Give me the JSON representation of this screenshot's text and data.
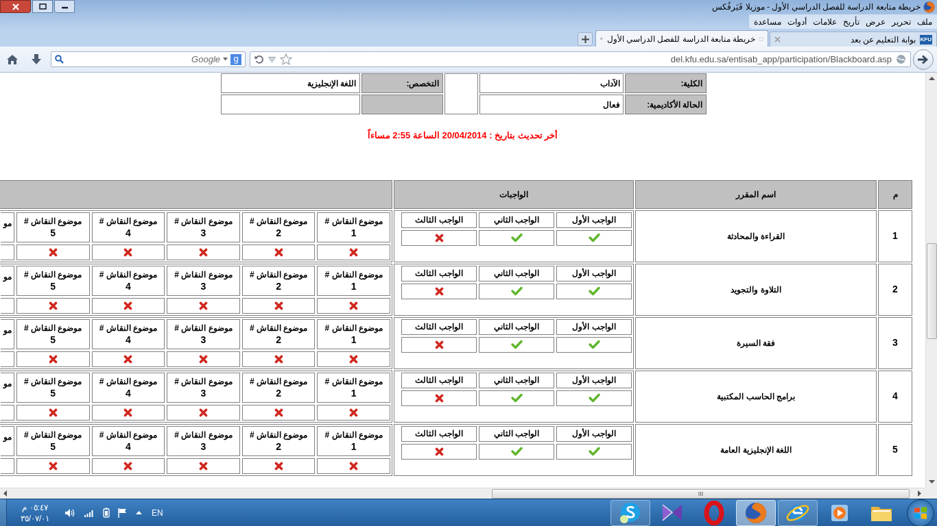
{
  "window": {
    "title": "خريطة متابعة الدراسة للفصل الدراسي الأول - موزيلا فَيَرفُكس"
  },
  "menu": [
    "ملف",
    "تحرير",
    "عرض",
    "تأريخ",
    "علامات",
    "أدوات",
    "مساعدة"
  ],
  "tabs": [
    {
      "label": "بوابة التعليم عن بعد",
      "favicon_text": "KFU",
      "selected": false
    },
    {
      "label": "خريطة متابعة الدراسة للفصل الدراسي الأول",
      "selected": true
    }
  ],
  "search": {
    "placeholder": "Google",
    "engine_badge": "g"
  },
  "address_bar": {
    "url": "del.kfu.edu.sa/entisab_app/participation/Blackboard.asp"
  },
  "student_info": [
    {
      "label": "الكلية:",
      "value": "الآداب"
    },
    {
      "label": "التخصص:",
      "value": "اللغة الإنجليزية"
    },
    {
      "label": "الحالة الأكاديمية:",
      "value": "فعال"
    }
  ],
  "last_update": "أخر تحديث بتاريخ : 20/04/2014 الساعة 2:55 مساءاً",
  "table": {
    "columns": [
      "م",
      "اسم المقرر",
      "الواجبات"
    ],
    "rows": [
      {
        "number": "1",
        "course": "القراءة والمحادثة",
        "assignments": [
          {
            "label": "الواجب الأول",
            "done": true
          },
          {
            "label": "الواجب الثاني",
            "done": true
          },
          {
            "label": "الواجب الثالث",
            "done": false
          }
        ],
        "discussions": [
          {
            "label": "موضوع النقاش #",
            "number": "1",
            "done": false
          },
          {
            "label": "موضوع النقاش #",
            "number": "2",
            "done": false
          },
          {
            "label": "موضوع النقاش #",
            "number": "3",
            "done": false
          },
          {
            "label": "موضوع النقاش #",
            "number": "4",
            "done": false
          },
          {
            "label": "موضوع النقاش #",
            "number": "5",
            "done": false
          }
        ],
        "discussion_cut": "مو"
      },
      {
        "number": "2",
        "course": "التلاوة والتجويد",
        "assignments": [
          {
            "label": "الواجب الأول",
            "done": true
          },
          {
            "label": "الواجب الثاني",
            "done": true
          },
          {
            "label": "الواجب الثالث",
            "done": false
          }
        ],
        "discussions": [
          {
            "label": "موضوع النقاش #",
            "number": "1",
            "done": false
          },
          {
            "label": "موضوع النقاش #",
            "number": "2",
            "done": false
          },
          {
            "label": "موضوع النقاش #",
            "number": "3",
            "done": false
          },
          {
            "label": "موضوع النقاش #",
            "number": "4",
            "done": false
          },
          {
            "label": "موضوع النقاش #",
            "number": "5",
            "done": false
          }
        ],
        "discussion_cut": "مو"
      },
      {
        "number": "3",
        "course": "فقة السيرة",
        "assignments": [
          {
            "label": "الواجب الأول",
            "done": true
          },
          {
            "label": "الواجب الثاني",
            "done": true
          },
          {
            "label": "الواجب الثالث",
            "done": false
          }
        ],
        "discussions": [
          {
            "label": "موضوع النقاش #",
            "number": "1",
            "done": false
          },
          {
            "label": "موضوع النقاش #",
            "number": "2",
            "done": false
          },
          {
            "label": "موضوع النقاش #",
            "number": "3",
            "done": false
          },
          {
            "label": "موضوع النقاش #",
            "number": "4",
            "done": false
          },
          {
            "label": "موضوع النقاش #",
            "number": "5",
            "done": false
          }
        ],
        "discussion_cut": "مو"
      },
      {
        "number": "4",
        "course": "برامج الحاسب المكتبية",
        "assignments": [
          {
            "label": "الواجب الأول",
            "done": true
          },
          {
            "label": "الواجب الثاني",
            "done": true
          },
          {
            "label": "الواجب الثالث",
            "done": false
          }
        ],
        "discussions": [
          {
            "label": "موضوع النقاش #",
            "number": "1",
            "done": false
          },
          {
            "label": "موضوع النقاش #",
            "number": "2",
            "done": false
          },
          {
            "label": "موضوع النقاش #",
            "number": "3",
            "done": false
          },
          {
            "label": "موضوع النقاش #",
            "number": "4",
            "done": false
          },
          {
            "label": "موضوع النقاش #",
            "number": "5",
            "done": false
          }
        ],
        "discussion_cut": "مو"
      },
      {
        "number": "5",
        "course": "اللغة الإنجليزية العامة",
        "assignments": [
          {
            "label": "الواجب الأول",
            "done": true
          },
          {
            "label": "الواجب الثاني",
            "done": true
          },
          {
            "label": "الواجب الثالث",
            "done": false
          }
        ],
        "discussions": [
          {
            "label": "موضوع النقاش #",
            "number": "1",
            "done": false
          },
          {
            "label": "موضوع النقاش #",
            "number": "2",
            "done": false
          },
          {
            "label": "موضوع النقاش #",
            "number": "3",
            "done": false
          },
          {
            "label": "موضوع النقاش #",
            "number": "4",
            "done": false
          },
          {
            "label": "موضوع النقاش #",
            "number": "5",
            "done": false
          }
        ],
        "discussion_cut": "مو"
      }
    ]
  },
  "taskbar": {
    "clock_time": "٠٥:٤٧ م",
    "clock_date": "٣٥/٠٧/٠١",
    "language": "EN",
    "apps": [
      {
        "kind": "chat",
        "running": true,
        "selected": false
      },
      {
        "kind": "bowtie",
        "running": false,
        "selected": false
      },
      {
        "kind": "ring",
        "running": false,
        "selected": false
      },
      {
        "kind": "fox",
        "running": true,
        "selected": true
      },
      {
        "kind": "orbit",
        "running": true,
        "selected": false
      },
      {
        "kind": "media",
        "running": false,
        "selected": false
      },
      {
        "kind": "folder",
        "running": false,
        "selected": false
      }
    ]
  }
}
